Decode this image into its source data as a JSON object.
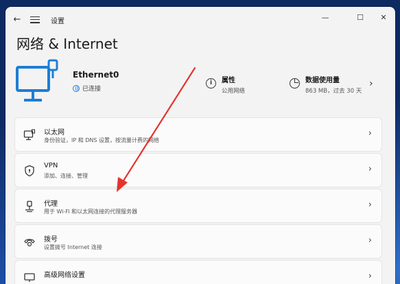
{
  "window": {
    "title": "设置"
  },
  "page": {
    "title": "网络 & Internet"
  },
  "connection": {
    "name": "Ethernet0",
    "status": "已连接"
  },
  "properties": {
    "label": "属性",
    "value": "公用网络"
  },
  "data_usage": {
    "label": "数据使用量",
    "value": "863 MB，过去 30 天"
  },
  "items": [
    {
      "label": "以太网",
      "desc": "身份验证，IP 和 DNS 设置，按流量计费的网络"
    },
    {
      "label": "VPN",
      "desc": "添加、连接、管理"
    },
    {
      "label": "代理",
      "desc": "用于 Wi-Fi 和以太网连接的代理服务器"
    },
    {
      "label": "拨号",
      "desc": "设置拨号 Internet 连接"
    },
    {
      "label": "高级网络设置",
      "desc": ""
    }
  ],
  "colors": {
    "accent": "#1c7ed6",
    "annotation_arrow": "#e5322d"
  }
}
